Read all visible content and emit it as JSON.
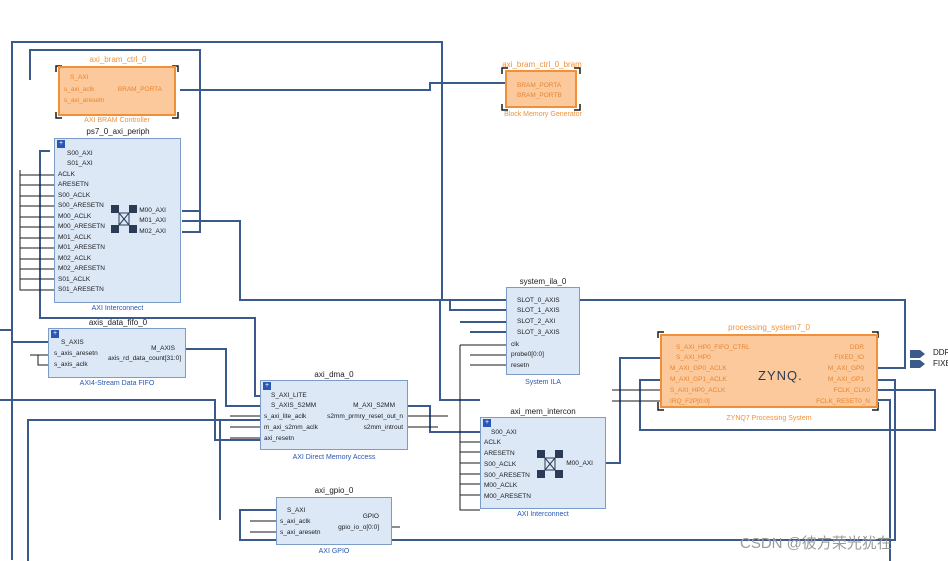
{
  "blocks": {
    "bram_ctrl": {
      "instance": "axi_bram_ctrl_0",
      "type_label": "AXI BRAM Controller",
      "left_pins": [
        "S_AXI",
        "s_axi_aclk",
        "s_axi_aresetn"
      ],
      "right_pins": [
        "BRAM_PORTA"
      ]
    },
    "bram_gen": {
      "instance": "axi_bram_ctrl_0_bram",
      "type_label": "Block Memory Generator",
      "left_pins": [
        "BRAM_PORTA",
        "BRAM_PORTB"
      ]
    },
    "periph": {
      "instance": "ps7_0_axi_periph",
      "type_label": "AXI Interconnect",
      "left_pins": [
        "S00_AXI",
        "S01_AXI",
        "ACLK",
        "ARESETN",
        "S00_ACLK",
        "S00_ARESETN",
        "M00_ACLK",
        "M00_ARESETN",
        "M01_ACLK",
        "M01_ARESETN",
        "M02_ACLK",
        "M02_ARESETN",
        "S01_ACLK",
        "S01_ARESETN"
      ],
      "right_pins": [
        "M00_AXI",
        "M01_AXI",
        "M02_AXI"
      ]
    },
    "fifo": {
      "instance": "axis_data_fifo_0",
      "type_label": "AXI4-Stream Data FIFO",
      "left_pins": [
        "S_AXIS",
        "s_axis_aresetn",
        "s_axis_aclk"
      ],
      "right_pins": [
        "M_AXIS",
        "axis_rd_data_count[31:0]"
      ]
    },
    "ila": {
      "instance": "system_ila_0",
      "type_label": "System ILA",
      "left_pins": [
        "SLOT_0_AXIS",
        "SLOT_1_AXIS",
        "SLOT_2_AXI",
        "SLOT_3_AXIS",
        "clk",
        "probe0[0:0]",
        "resetn"
      ]
    },
    "zynq": {
      "instance": "processing_system7_0",
      "type_label": "ZYNQ7 Processing System",
      "logo": "ZYNQ.",
      "left_pins": [
        "S_AXI_HP0_FIFO_CTRL",
        "S_AXI_HP0",
        "M_AXI_GP0_ACLK",
        "M_AXI_GP1_ACLK",
        "S_AXI_HP0_ACLK",
        "IRQ_F2P[0:0]"
      ],
      "right_pins": [
        "DDR",
        "FIXED_IO",
        "M_AXI_GP0",
        "M_AXI_GP1",
        "FCLK_CLK0",
        "FCLK_RESET0_N"
      ]
    },
    "dma": {
      "instance": "axi_dma_0",
      "type_label": "AXI Direct Memory Access",
      "left_pins": [
        "S_AXI_LITE",
        "S_AXIS_S2MM",
        "s_axi_lite_aclk",
        "m_axi_s2mm_aclk",
        "axi_resetn"
      ],
      "right_pins": [
        "M_AXI_S2MM",
        "s2mm_prmry_reset_out_n",
        "s2mm_introut"
      ]
    },
    "mem": {
      "instance": "axi_mem_intercon",
      "type_label": "AXI Interconnect",
      "left_pins": [
        "S00_AXI",
        "ACLK",
        "ARESETN",
        "S00_ACLK",
        "S00_ARESETN",
        "M00_ACLK",
        "M00_ARESETN"
      ],
      "right_pins": [
        "M00_AXI"
      ]
    },
    "gpio": {
      "instance": "axi_gpio_0",
      "type_label": "AXI GPIO",
      "left_pins": [
        "S_AXI",
        "s_axi_aclk",
        "s_axi_aresetn"
      ],
      "right_pins": [
        "GPIO",
        "gpio_io_o[0:0]"
      ]
    }
  },
  "external_ports": [
    "DDR",
    "FIXED_IO"
  ],
  "watermark": "CSDN @彼方荣光犹在",
  "colors": {
    "wire": "#3b5a8c",
    "block_fill": "#dde8f7",
    "block_border": "#7a9cc6",
    "selected_fill": "#fbc99b",
    "selected_border": "#f0913a",
    "label_blue": "#2a56b4"
  }
}
